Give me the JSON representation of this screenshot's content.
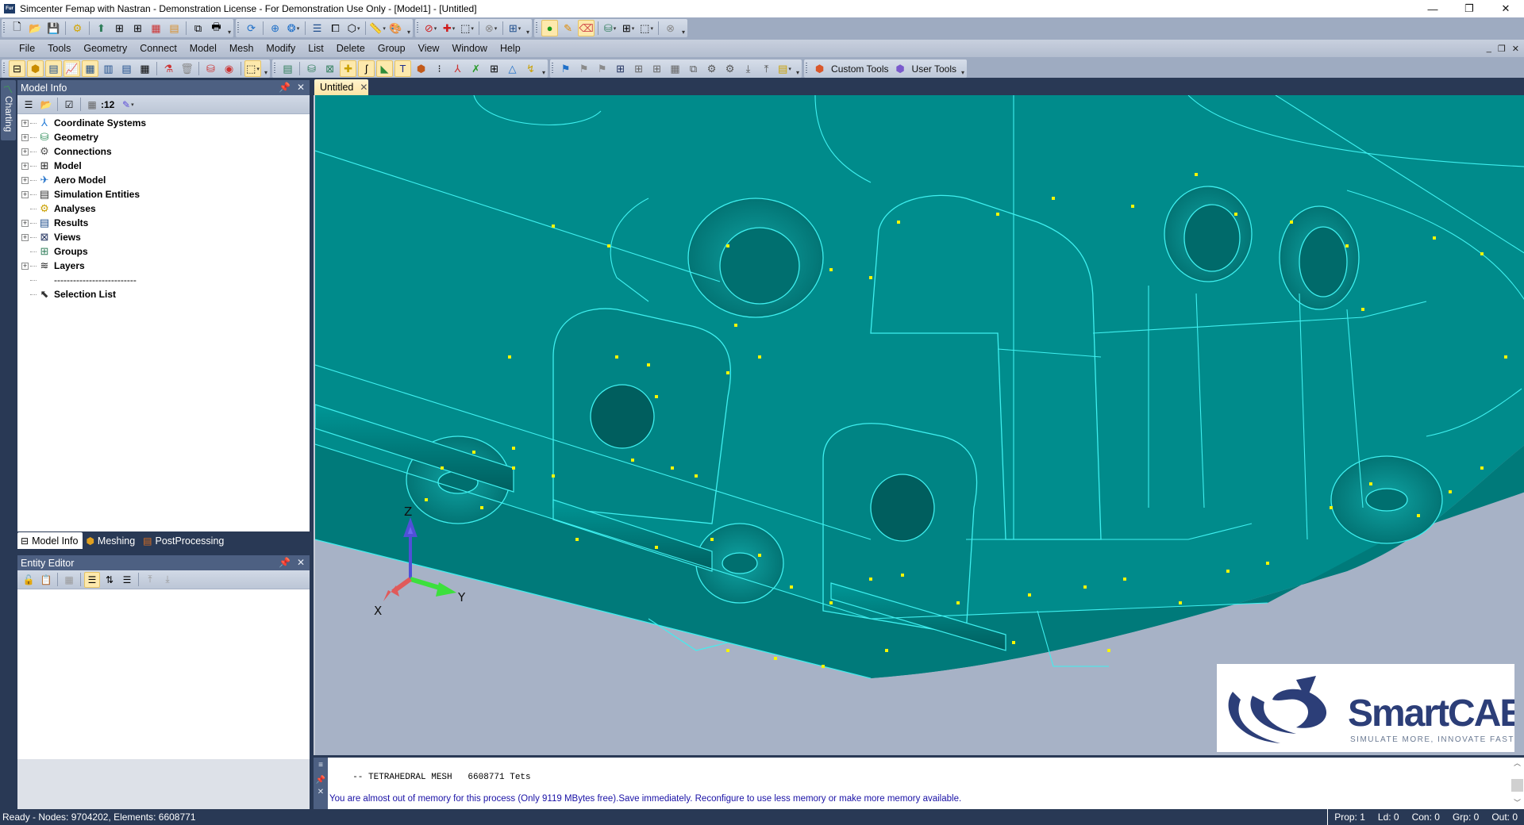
{
  "titlebar": {
    "app_icon": "Fur",
    "title": "Simcenter Femap with Nastran - Demonstration License - For Demonstration Use Only - [Model1] - [Untitled]",
    "minimize": "—",
    "restore": "❐",
    "close": "✕"
  },
  "toolbar_row1": {
    "groups": [
      {
        "icons": [
          "new-file-icon",
          "open-folder-icon",
          "save-icon",
          "|",
          "gears-icon",
          "|",
          "geometry-import-icon",
          "mesh-up-icon",
          "mesh-down-icon",
          "mesh-color-icon",
          "open-mesh-icon",
          "|",
          "copy-icon",
          "print-icon"
        ]
      },
      {
        "icons": [
          "rotate-icon",
          "|",
          "zoom-icon",
          "dynamic-icon",
          "|",
          "list-icon",
          "window-icon",
          "cube-view-icon",
          "|",
          "ruler-icon",
          "palette-icon"
        ]
      },
      {
        "icons": [
          "no-select-icon",
          "add-select-icon",
          "box-select-icon",
          "|",
          "delete-disabled-icon",
          "|",
          "workplane-icon"
        ]
      },
      {
        "icons": [
          "node-edit-icon",
          "pencil-icon",
          "eraser-icon",
          "|",
          "solid-edit-icon",
          "grid-edit-icon",
          "box-edit-icon",
          "|",
          "clear-disabled-icon"
        ]
      }
    ]
  },
  "menu": {
    "items": [
      "File",
      "Tools",
      "Geometry",
      "Connect",
      "Model",
      "Mesh",
      "Modify",
      "List",
      "Delete",
      "Group",
      "View",
      "Window",
      "Help"
    ],
    "mdi_minimize": "_",
    "mdi_restore": "❐",
    "mdi_close": "✕"
  },
  "toolbar_row3": {
    "custom_tools": "Custom Tools",
    "user_tools": "User Tools"
  },
  "charting_tab": "Charting",
  "model_info": {
    "title": "Model Info",
    "toolbar_count": ":12",
    "tree": [
      {
        "label": "Coordinate Systems",
        "expandable": true,
        "icon": "coordinate-systems-icon"
      },
      {
        "label": "Geometry",
        "expandable": true,
        "icon": "geometry-icon"
      },
      {
        "label": "Connections",
        "expandable": true,
        "icon": "connections-icon"
      },
      {
        "label": "Model",
        "expandable": true,
        "icon": "model-icon"
      },
      {
        "label": "Aero Model",
        "expandable": true,
        "icon": "aero-model-icon"
      },
      {
        "label": "Simulation Entities",
        "expandable": true,
        "icon": "simulation-entities-icon"
      },
      {
        "label": "Analyses",
        "expandable": false,
        "icon": "analyses-icon"
      },
      {
        "label": "Results",
        "expandable": true,
        "icon": "results-icon"
      },
      {
        "label": "Views",
        "expandable": true,
        "icon": "views-icon"
      },
      {
        "label": "Groups",
        "expandable": false,
        "icon": "groups-icon"
      },
      {
        "label": "Layers",
        "expandable": true,
        "icon": "layers-icon"
      },
      {
        "label": "--------------------------",
        "expandable": false,
        "icon": ""
      },
      {
        "label": "Selection List",
        "expandable": false,
        "icon": "selection-list-icon"
      }
    ],
    "tabs": [
      {
        "label": "Model Info",
        "active": true
      },
      {
        "label": "Meshing",
        "active": false
      },
      {
        "label": "PostProcessing",
        "active": false
      }
    ]
  },
  "entity_editor": {
    "title": "Entity Editor"
  },
  "view": {
    "tab_label": "Untitled",
    "model_color": "#008b8b",
    "edge_color": "#3ef0f0",
    "point_color": "#f5f500",
    "background_color": "#a7b2c6",
    "triad": {
      "x": "X",
      "y": "Y",
      "z": "Z"
    },
    "logo": {
      "name": "SmartCAE",
      "tagline": "SIMULATE MORE, INNOVATE FASTER"
    }
  },
  "messages": {
    "line1": "  -- TETRAHEDRAL MESH   6608771 Tets",
    "line2": "You are almost out of memory for this process (Only 9119 MBytes free).Save immediately. Reconfigure to use less memory or make more memory available."
  },
  "statusbar": {
    "left": "Ready - Nodes: 9704202,  Elements: 6608771",
    "prop": "Prop: 1",
    "ld": "Ld: 0",
    "con": "Con: 0",
    "grp": "Grp: 0",
    "out": "Out: 0"
  }
}
